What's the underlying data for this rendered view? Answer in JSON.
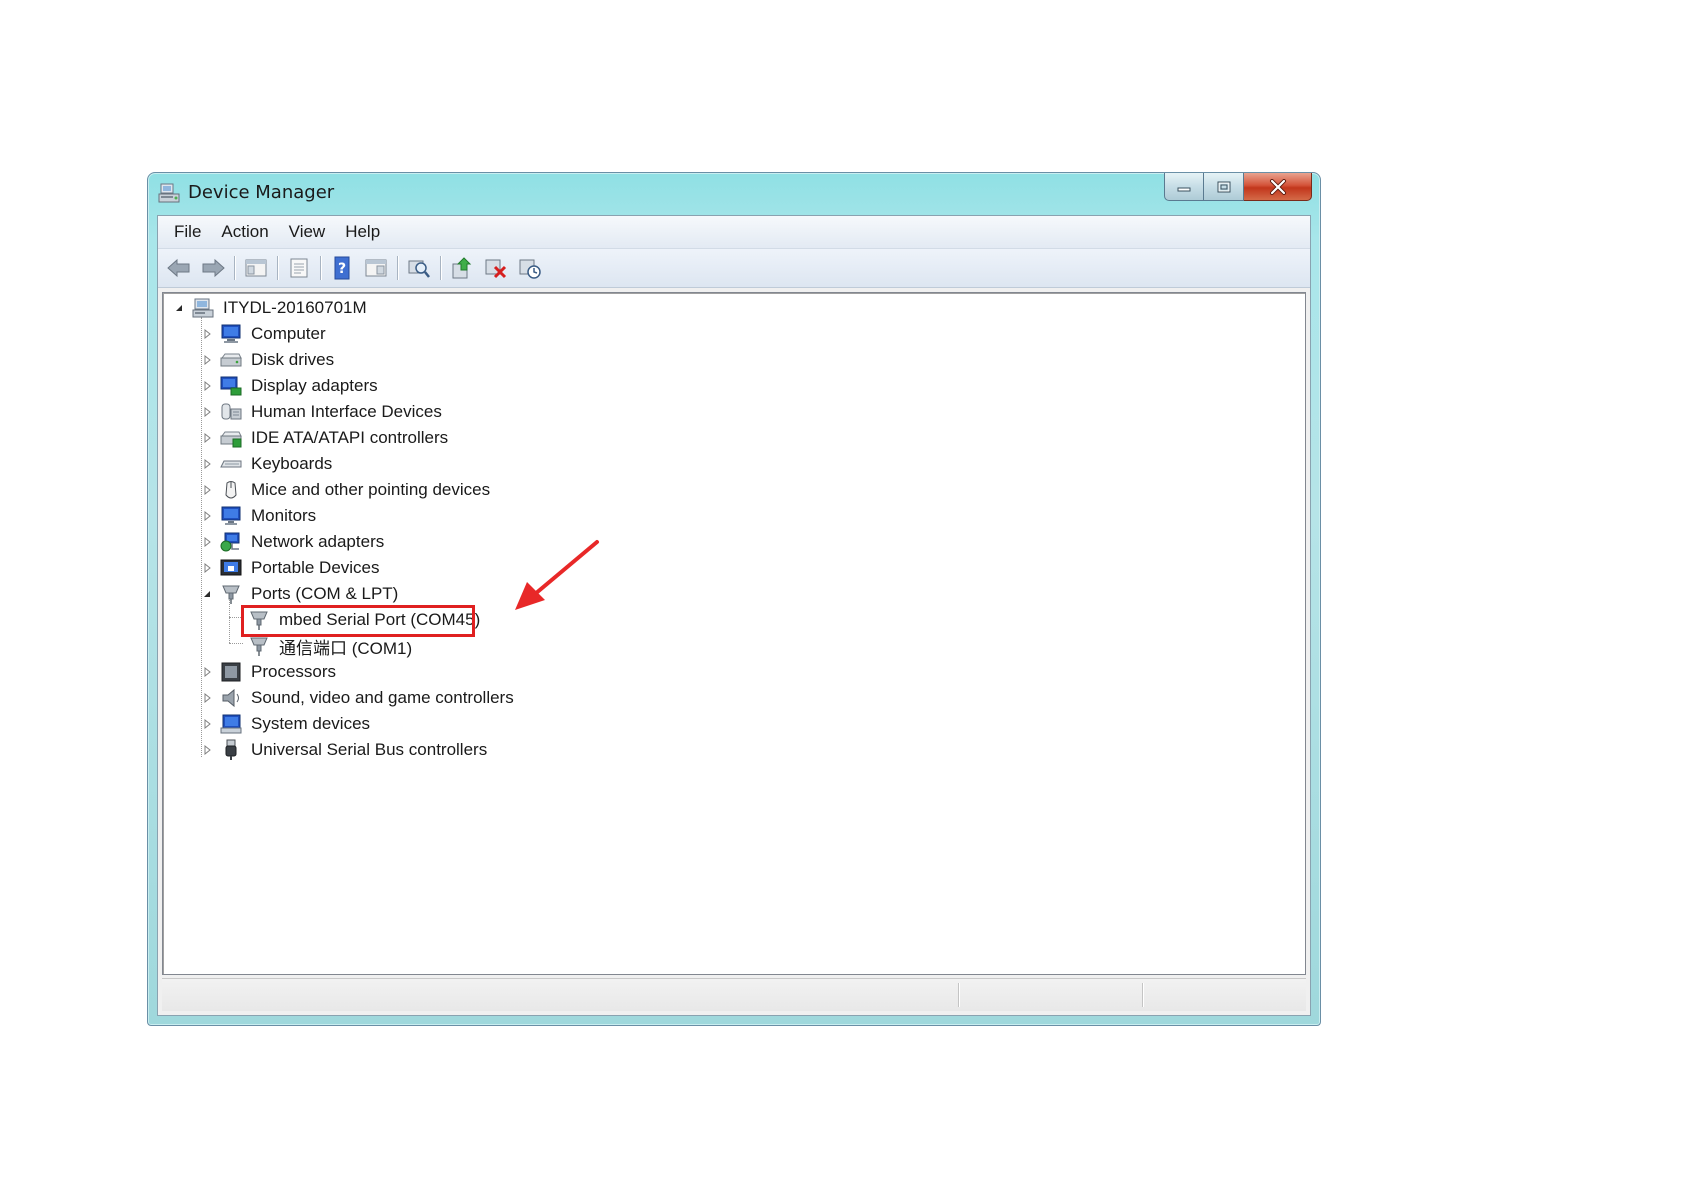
{
  "window": {
    "title": "Device Manager",
    "controls": {
      "minimize": "minimize",
      "maximize": "maximize",
      "close": "close"
    }
  },
  "menu": {
    "items": [
      "File",
      "Action",
      "View",
      "Help"
    ]
  },
  "toolbar": {
    "buttons": [
      {
        "icon": "back-arrow-icon"
      },
      {
        "icon": "forward-arrow-icon"
      },
      {
        "icon": "show-hide-console-tree-icon"
      },
      {
        "icon": "properties-icon"
      },
      {
        "icon": "help-icon"
      },
      {
        "icon": "action-pane-icon"
      },
      {
        "icon": "scan-hardware-changes-icon"
      },
      {
        "icon": "update-driver-icon"
      },
      {
        "icon": "uninstall-device-icon"
      },
      {
        "icon": "disable-device-icon"
      }
    ]
  },
  "tree": {
    "root": {
      "label": "ITYDL-20160701M",
      "expanded": true
    },
    "categories": [
      {
        "label": "Computer",
        "icon": "computer-icon"
      },
      {
        "label": "Disk drives",
        "icon": "disk-drive-icon"
      },
      {
        "label": "Display adapters",
        "icon": "display-adapter-icon"
      },
      {
        "label": "Human Interface Devices",
        "icon": "hid-icon"
      },
      {
        "label": "IDE ATA/ATAPI controllers",
        "icon": "ide-controller-icon"
      },
      {
        "label": "Keyboards",
        "icon": "keyboard-icon"
      },
      {
        "label": "Mice and other pointing devices",
        "icon": "mouse-icon"
      },
      {
        "label": "Monitors",
        "icon": "monitor-icon"
      },
      {
        "label": "Network adapters",
        "icon": "network-adapter-icon"
      },
      {
        "label": "Portable Devices",
        "icon": "portable-device-icon"
      },
      {
        "label": "Ports (COM & LPT)",
        "icon": "port-icon",
        "expanded": true,
        "children": [
          {
            "label": "mbed Serial Port (COM45)",
            "icon": "port-icon",
            "highlighted": true
          },
          {
            "label": "通信端口 (COM1)",
            "icon": "port-icon"
          }
        ]
      },
      {
        "label": "Processors",
        "icon": "processor-icon"
      },
      {
        "label": "Sound, video and game controllers",
        "icon": "speaker-icon"
      },
      {
        "label": "System devices",
        "icon": "system-device-icon"
      },
      {
        "label": "Universal Serial Bus controllers",
        "icon": "usb-icon"
      }
    ]
  },
  "colors": {
    "highlight_box": "#e02020",
    "arrow": "#e82828",
    "title_bar": "#9fe0e4"
  }
}
